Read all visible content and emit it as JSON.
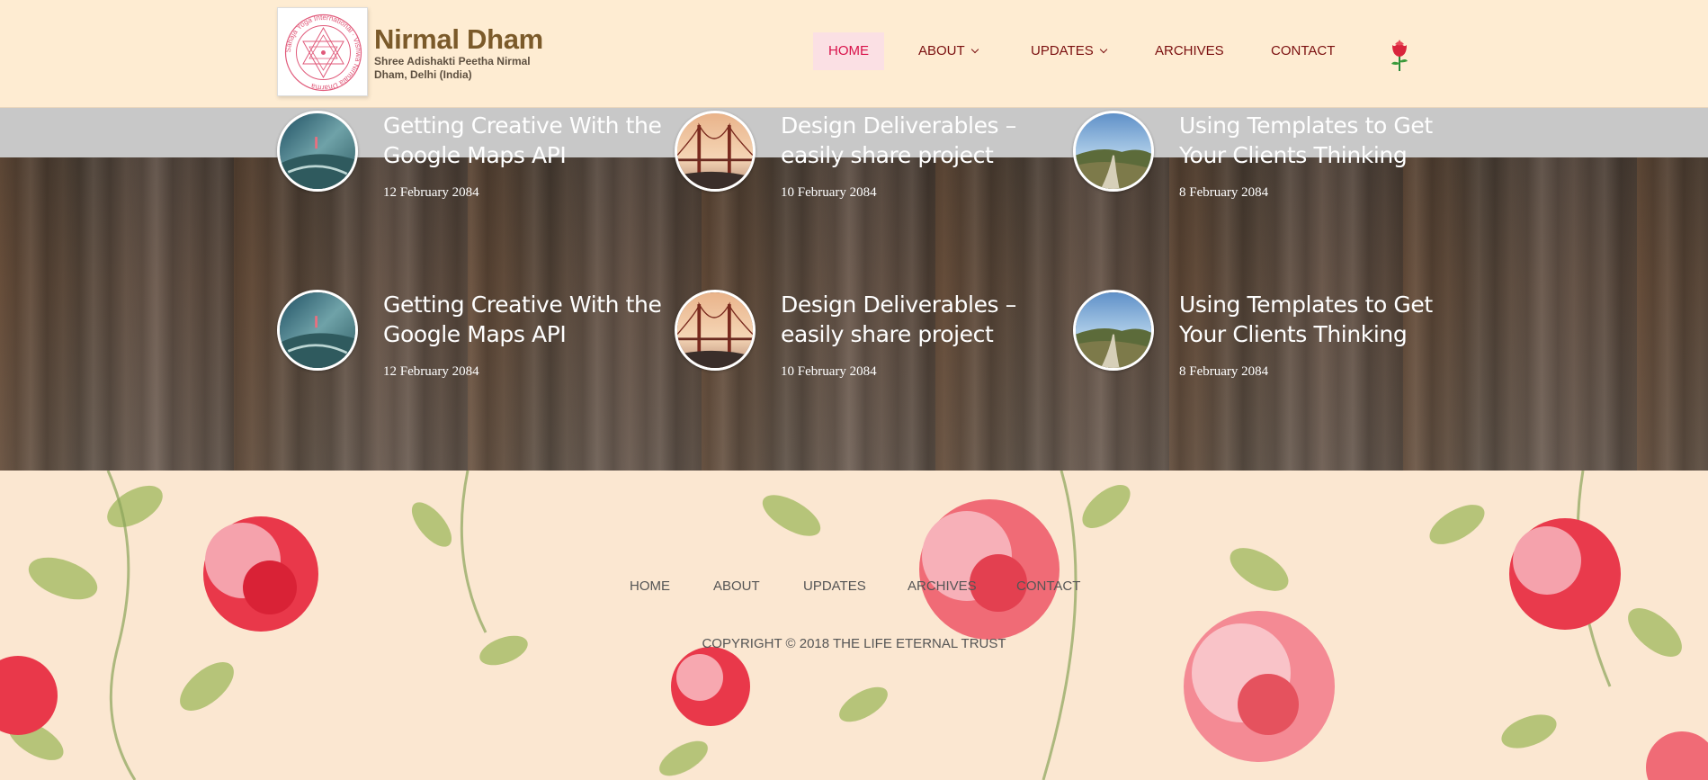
{
  "brand": {
    "title": "Nirmal Dham",
    "tagline": "Shree Adishakti Peetha Nirmal Dham, Delhi (India)",
    "logo_text": "Sahaja Yoga International · Vishwa Nirmala Dharma"
  },
  "nav": {
    "items": [
      {
        "label": "HOME",
        "active": true
      },
      {
        "label": "ABOUT",
        "has_dropdown": true
      },
      {
        "label": "UPDATES",
        "has_dropdown": true
      },
      {
        "label": "ARCHIVES"
      },
      {
        "label": "CONTACT"
      }
    ],
    "icon": "rose-icon"
  },
  "posts": [
    {
      "title": "Getting Creative With the Google Maps API",
      "date": "12 February 2084",
      "thumb": "cliff-surfer"
    },
    {
      "title": "Design Deliverables – easily share project",
      "date": "10 February 2084",
      "thumb": "golden-gate"
    },
    {
      "title": "Using Templates to Get Your Clients Thinking",
      "date": "8 February 2084",
      "thumb": "mountain-road"
    },
    {
      "title": "Getting Creative With the Google Maps API",
      "date": "12 February 2084",
      "thumb": "cliff-surfer"
    },
    {
      "title": "Design Deliverables – easily share project",
      "date": "10 February 2084",
      "thumb": "golden-gate"
    },
    {
      "title": "Using Templates to Get Your Clients Thinking",
      "date": "8 February 2084",
      "thumb": "mountain-road"
    }
  ],
  "footer": {
    "links": [
      "HOME",
      "ABOUT",
      "UPDATES",
      "ARCHIVES",
      "CONTACT"
    ],
    "copyright": "COPYRIGHT © 2018 THE LIFE ETERNAL TRUST"
  },
  "colors": {
    "header_bg": "#feecd2",
    "nav_text": "#7b1010",
    "nav_active_text": "#d9114a",
    "nav_active_bg": "#fbe0e4",
    "brand_title": "#7b5a2a"
  }
}
